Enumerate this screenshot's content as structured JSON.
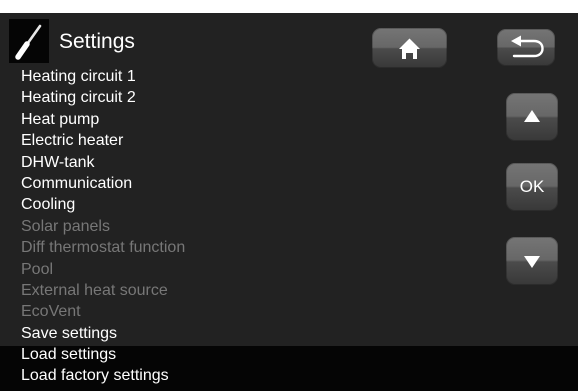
{
  "header": {
    "title": "Settings",
    "icon": "screwdriver-icon"
  },
  "buttons": {
    "home_icon": "home-icon",
    "back_icon": "back-arrow-icon",
    "up_icon": "triangle-up-icon",
    "ok_label": "OK",
    "down_icon": "triangle-down-icon"
  },
  "menu": {
    "items": [
      {
        "label": "Heating circuit 1",
        "enabled": true
      },
      {
        "label": "Heating circuit 2",
        "enabled": true
      },
      {
        "label": "Heat pump",
        "enabled": true
      },
      {
        "label": "Electric heater",
        "enabled": true
      },
      {
        "label": "DHW-tank",
        "enabled": true
      },
      {
        "label": "Communication",
        "enabled": true
      },
      {
        "label": "Cooling",
        "enabled": true
      },
      {
        "label": "Solar panels",
        "enabled": false
      },
      {
        "label": "Diff thermostat function",
        "enabled": false
      },
      {
        "label": "Pool",
        "enabled": false
      },
      {
        "label": "External heat source",
        "enabled": false
      },
      {
        "label": "EcoVent",
        "enabled": false
      },
      {
        "label": "Save settings",
        "enabled": true
      },
      {
        "label": "Load settings",
        "enabled": true
      },
      {
        "label": "Load factory settings",
        "enabled": true
      }
    ]
  },
  "colors": {
    "main_background": "#222222",
    "bottom_background": "#050505",
    "enabled_text": "#ffffff",
    "disabled_text": "#777777"
  }
}
